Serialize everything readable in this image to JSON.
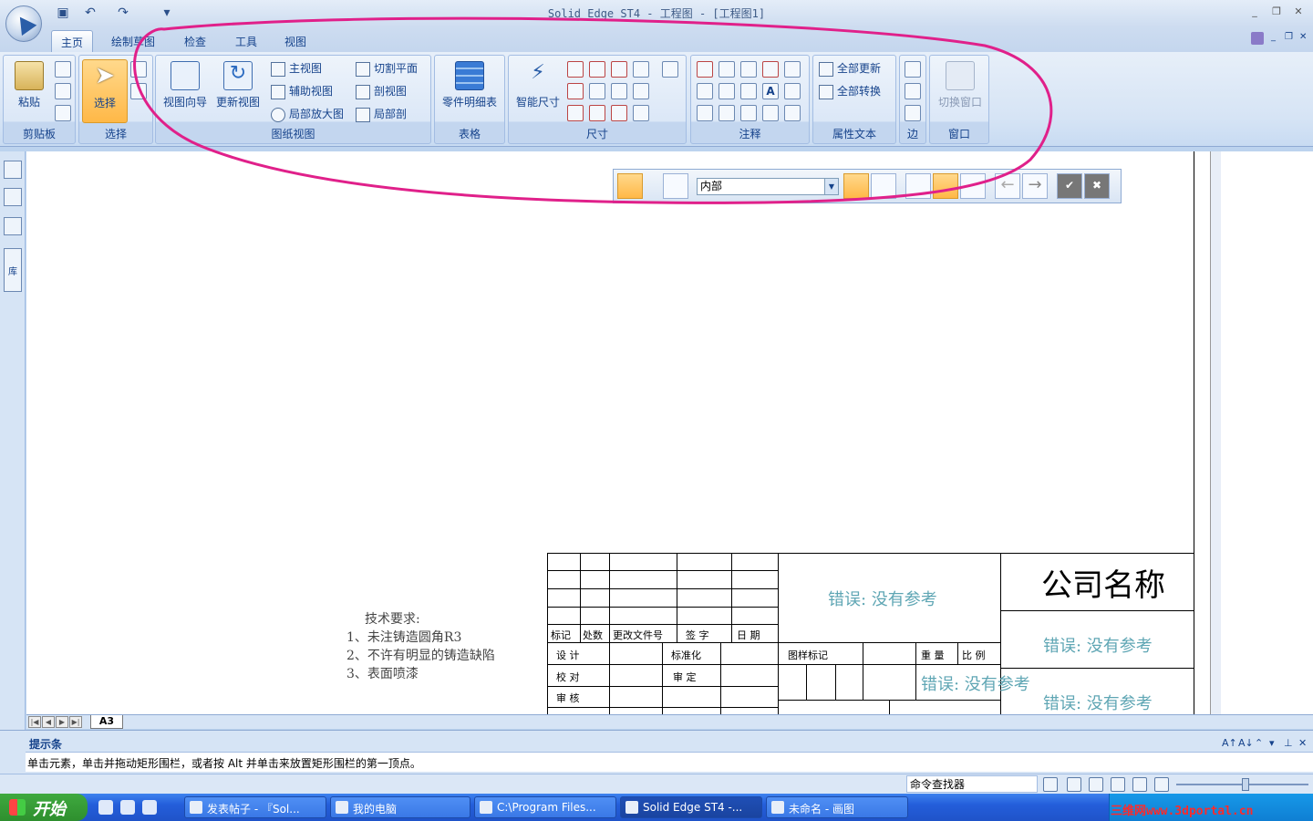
{
  "window": {
    "title": "Solid Edge ST4 - 工程图 - [工程图1]"
  },
  "tabs": [
    "主页",
    "绘制草图",
    "检查",
    "工具",
    "视图"
  ],
  "ribbon": {
    "clipboard": {
      "label": "剪贴板",
      "paste": "粘贴"
    },
    "select": {
      "label": "选择",
      "select_btn": "选择"
    },
    "drawing_views": {
      "label": "图纸视图",
      "view_wizard": "视图向导",
      "update_views": "更新视图",
      "principal_view": "主视图",
      "auxiliary_view": "辅助视图",
      "detail_view": "局部放大图",
      "cutting_plane": "切割平面",
      "section_view": "剖视图",
      "broken_out": "局部剖"
    },
    "table": {
      "label": "表格",
      "parts_list": "零件明细表"
    },
    "dimension": {
      "label": "尺寸",
      "smart_dimension": "智能尺寸"
    },
    "annotation": {
      "label": "注释"
    },
    "property_text": {
      "label": "属性文本",
      "update_all": "全部更新",
      "convert_all": "全部转换"
    },
    "edge": {
      "label": "边"
    },
    "window_group": {
      "label": "窗口",
      "switch_window": "切换窗口"
    }
  },
  "select_toolbar": {
    "filter_value": "内部"
  },
  "left_toolbar": {
    "library_label": "库"
  },
  "drawing": {
    "tech_req": {
      "title": "技术要求:",
      "items": [
        "1、未注铸造圆角R3",
        "2、不许有明显的铸造缺陷",
        "3、表面喷漆"
      ]
    },
    "title_block": {
      "company": "公司名称",
      "error_text": "错误: 没有参考",
      "rev_headers": [
        "标记",
        "处数",
        "更改文件号",
        "签 字",
        "日 期"
      ],
      "design": "设 计",
      "standardization": "标准化",
      "check": "校 对",
      "review": "审 定",
      "approve": "审 核",
      "sample_mark": "图样标记",
      "weight": "重 量",
      "scale": "比 例"
    }
  },
  "sheet_tab": "A3",
  "prompt_bar": {
    "title": "提示条",
    "message": "单击元素，单击并拖动矩形围栏，或者按 Alt 并单击来放置矩形围栏的第一顶点。"
  },
  "status_bar": {
    "command_finder": "命令查找器"
  },
  "taskbar": {
    "start": "开始",
    "tasks": [
      "发表帖子 - 『Sol...",
      "我的电脑",
      "C:\\Program Files...",
      "Solid Edge ST4 -...",
      "未命名 - 画图"
    ],
    "watermark": "三维网www.3dportal.cn"
  }
}
